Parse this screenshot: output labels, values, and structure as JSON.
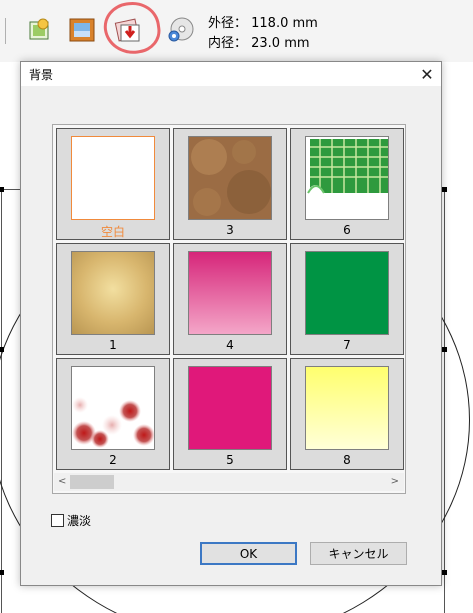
{
  "toolbar": {
    "outer_diameter": "外径： 118.0 mm",
    "inner_diameter": "内径： 23.0 mm"
  },
  "dialog": {
    "title": "背景",
    "close_glyph": "✕",
    "tiles": [
      {
        "label": "空白",
        "selected": true,
        "fill": "#ffffff"
      },
      {
        "label": "3",
        "selected": false,
        "fill": "#9b6c44"
      },
      {
        "label": "6",
        "selected": false,
        "fill": "#4caa4c"
      },
      {
        "label": "1",
        "selected": false,
        "fill": "#d8b66e"
      },
      {
        "label": "4",
        "selected": false,
        "fill": "#e05a9a"
      },
      {
        "label": "7",
        "selected": false,
        "fill": "#009444"
      },
      {
        "label": "2",
        "selected": false,
        "fill": "#b42828"
      },
      {
        "label": "5",
        "selected": false,
        "fill": "#e0187a"
      },
      {
        "label": "8",
        "selected": false,
        "fill": "#ffff70"
      }
    ],
    "scroll_left": "<",
    "scroll_right": ">",
    "checkbox_label": "濃淡",
    "ok_label": "OK",
    "cancel_label": "キャンセル"
  }
}
